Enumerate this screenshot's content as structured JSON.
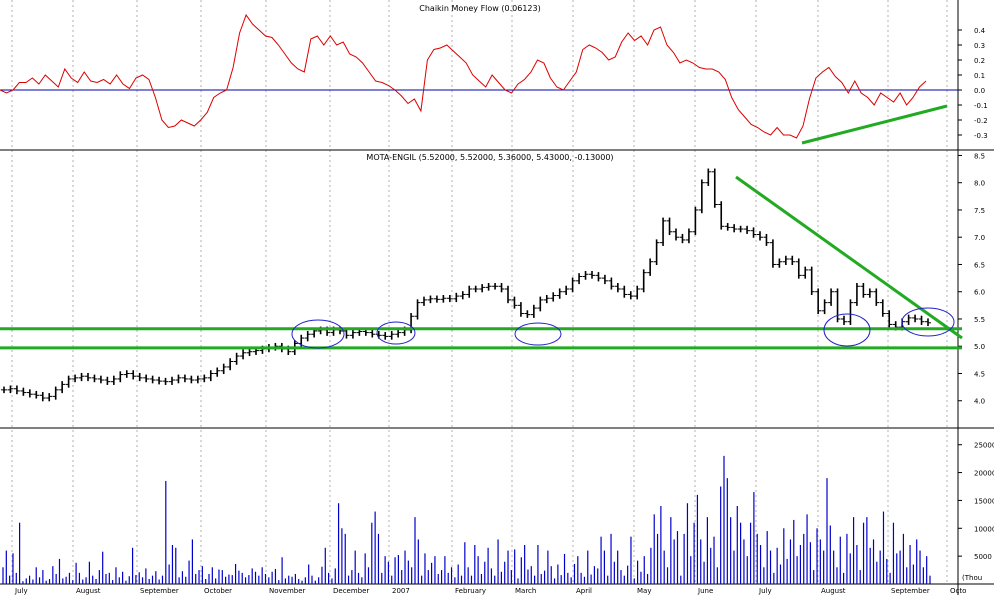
{
  "chart_data": [
    {
      "type": "line",
      "title": "Chaikin Money Flow (0.06123)",
      "ylim": [
        -0.4,
        0.6
      ],
      "y_ticks": [
        "0.4",
        "0.3",
        "0.2",
        "0.1",
        "0.0",
        "-0.1",
        "-0.2",
        "-0.3"
      ],
      "baseline": 0.0,
      "series": [
        {
          "color": "#dd0000",
          "values": [
            0.0,
            -0.02,
            0.0,
            0.05,
            0.05,
            0.08,
            0.04,
            0.1,
            0.06,
            0.02,
            0.14,
            0.08,
            0.05,
            0.12,
            0.06,
            0.05,
            0.07,
            0.04,
            0.1,
            0.04,
            0.01,
            0.08,
            0.1,
            0.07,
            -0.05,
            -0.2,
            -0.25,
            -0.24,
            -0.2,
            -0.22,
            -0.24,
            -0.2,
            -0.15,
            -0.05,
            -0.02,
            0.0,
            0.15,
            0.38,
            0.5,
            0.44,
            0.4,
            0.36,
            0.35,
            0.3,
            0.24,
            0.18,
            0.14,
            0.12,
            0.34,
            0.36,
            0.3,
            0.36,
            0.3,
            0.32,
            0.24,
            0.22,
            0.18,
            0.12,
            0.06,
            0.05,
            0.03,
            0.0,
            -0.04,
            -0.09,
            -0.06,
            -0.14,
            0.2,
            0.27,
            0.28,
            0.3,
            0.26,
            0.22,
            0.18,
            0.1,
            0.06,
            0.02,
            0.1,
            0.05,
            0.0,
            -0.02,
            0.04,
            0.07,
            0.12,
            0.2,
            0.18,
            0.08,
            0.02,
            0.0,
            0.06,
            0.12,
            0.27,
            0.3,
            0.28,
            0.25,
            0.2,
            0.22,
            0.32,
            0.38,
            0.33,
            0.36,
            0.3,
            0.4,
            0.42,
            0.3,
            0.25,
            0.18,
            0.2,
            0.18,
            0.15,
            0.14,
            0.14,
            0.12,
            0.07,
            -0.05,
            -0.13,
            -0.18,
            -0.23,
            -0.25,
            -0.28,
            -0.3,
            -0.25,
            -0.3,
            -0.3,
            -0.32,
            -0.24,
            -0.06,
            0.08,
            0.12,
            0.15,
            0.09,
            0.05,
            -0.02,
            0.06,
            -0.02,
            -0.05,
            -0.1,
            -0.02,
            -0.05,
            -0.08,
            -0.02,
            -0.1,
            -0.05,
            0.02,
            0.06
          ]
        }
      ]
    },
    {
      "type": "line",
      "title": "MOTA-ENGIL (5.52000, 5.52000, 5.36000, 5.43000, -0.13000)",
      "ylim": [
        3.5,
        8.6
      ],
      "y_ticks": [
        "8.5",
        "8.0",
        "7.5",
        "7.0",
        "6.5",
        "6.0",
        "5.5",
        "5.0",
        "4.5",
        "4.0"
      ],
      "series": [
        {
          "color": "#000000",
          "values": [
            4.2,
            4.22,
            4.18,
            4.15,
            4.12,
            4.1,
            4.05,
            4.08,
            4.2,
            4.3,
            4.4,
            4.42,
            4.45,
            4.42,
            4.4,
            4.38,
            4.35,
            4.4,
            4.48,
            4.5,
            4.45,
            4.42,
            4.4,
            4.38,
            4.36,
            4.35,
            4.38,
            4.42,
            4.4,
            4.38,
            4.4,
            4.42,
            4.5,
            4.55,
            4.62,
            4.72,
            4.82,
            4.88,
            4.9,
            4.92,
            4.95,
            4.98,
            5.0,
            4.95,
            4.9,
            5.05,
            5.15,
            5.22,
            5.28,
            5.3,
            5.25,
            5.3,
            5.28,
            5.2,
            5.25,
            5.27,
            5.25,
            5.22,
            5.2,
            5.18,
            5.22,
            5.25,
            5.3,
            5.55,
            5.8,
            5.85,
            5.87,
            5.86,
            5.88,
            5.87,
            5.92,
            5.95,
            6.05,
            6.05,
            6.08,
            6.1,
            6.1,
            6.05,
            5.85,
            5.75,
            5.6,
            5.58,
            5.7,
            5.85,
            5.88,
            5.93,
            6.0,
            6.05,
            6.2,
            6.28,
            6.32,
            6.3,
            6.25,
            6.2,
            6.1,
            6.05,
            5.95,
            5.92,
            6.05,
            6.35,
            6.55,
            6.9,
            7.3,
            7.1,
            7.0,
            6.95,
            7.1,
            7.5,
            8.0,
            8.2,
            7.6,
            7.2,
            7.18,
            7.15,
            7.15,
            7.12,
            7.05,
            7.0,
            6.9,
            6.5,
            6.55,
            6.6,
            6.55,
            6.3,
            6.4,
            6.0,
            5.65,
            5.8,
            6.0,
            5.5,
            5.45,
            5.8,
            6.1,
            5.95,
            6.0,
            5.8,
            5.6,
            5.4,
            5.35,
            5.45,
            5.52,
            5.5,
            5.45,
            5.43
          ]
        }
      ],
      "annotations": {
        "support_lines": [
          5.32,
          4.97
        ],
        "trendline_from": [
          0,
          8.3
        ],
        "trendline_to": [
          1,
          5.28
        ]
      }
    },
    {
      "type": "bar",
      "title": "",
      "ylim": [
        0,
        28000
      ],
      "y_ticks": [
        "25000",
        "20000",
        "15000",
        "10000",
        "5000"
      ],
      "unit_label": "(Thou",
      "x_labels": [
        "July",
        "August",
        "September",
        "October",
        "November",
        "December",
        "2007",
        "February",
        "March",
        "April",
        "May",
        "June",
        "July",
        "August",
        "September",
        "Octo"
      ],
      "series": [
        {
          "color": "#0000cc",
          "values": [
            3000,
            6000,
            1500,
            5500,
            2000,
            11000,
            500,
            1000,
            1500,
            800,
            3000,
            1200,
            2500,
            600,
            900,
            3200,
            1800,
            4500,
            1000,
            1300,
            2000,
            700,
            3800,
            2000,
            800,
            1200,
            4000,
            1500,
            900,
            2500,
            5800,
            1800,
            2000,
            700,
            3000,
            1200,
            2200,
            600,
            1400,
            6500,
            1600,
            2100,
            1200,
            2800,
            900,
            1500,
            2300,
            800,
            1500,
            18500,
            3500,
            7000,
            6500,
            1200,
            2300,
            1300,
            4200,
            8000,
            1800,
            2500,
            3200,
            900,
            1800,
            3000,
            1000,
            2600,
            2500,
            1300,
            1700,
            1600,
            3600,
            2400,
            2000,
            1200,
            1600,
            2800,
            2200,
            1500,
            3000,
            1800,
            1200,
            2200,
            2700,
            700,
            4800,
            1000,
            1500,
            1300,
            1800,
            900,
            600,
            1200,
            3500,
            1500,
            600,
            1200,
            3100,
            6500,
            2000,
            1000,
            2800,
            14500,
            10000,
            9000,
            1500,
            2500,
            6000,
            2000,
            1200,
            5500,
            3000,
            11000,
            13000,
            9000,
            2000,
            5000,
            4000,
            1500,
            4800,
            5200,
            2500,
            6000,
            4200,
            3000,
            12000,
            8000,
            1500,
            5500,
            2500,
            3800,
            5000,
            1800,
            2500,
            5000,
            2000,
            3000,
            1200,
            3500,
            1500,
            7500,
            3000,
            1500,
            7000,
            5000,
            1800,
            4000,
            6500,
            2800,
            1500,
            8000,
            2200,
            4000,
            6000,
            2500,
            6200,
            1000,
            4800,
            7000,
            2600,
            3200,
            1500,
            7000,
            1800,
            2400,
            6000,
            3200,
            1000,
            3500,
            1600,
            5400,
            2000,
            1200,
            3600,
            5000,
            2000,
            1300,
            6000,
            1700,
            3200,
            2800,
            8500,
            6000,
            1500,
            9000,
            4000,
            6000,
            2500,
            1500,
            3300,
            8500,
            1000,
            4200,
            2200,
            5000,
            1800,
            6500,
            12500,
            9000,
            14000,
            6000,
            3000,
            12000,
            8000,
            9500,
            1500,
            9000,
            14500,
            5000,
            11000,
            16000,
            8000,
            4000,
            12000,
            6500,
            8500,
            3000,
            17500,
            23000,
            19000,
            12000,
            6000,
            14000,
            11000,
            8000,
            5000,
            11000,
            16500,
            9000,
            7000,
            3000,
            9500,
            6000,
            2000,
            6500,
            3500,
            10000,
            4500,
            8000,
            11500,
            5000,
            7000,
            9000,
            12500,
            7500,
            2500,
            10000,
            8000,
            6000,
            19000,
            10500,
            6000,
            3000,
            8500,
            2000,
            9000,
            5500,
            12000,
            7000,
            2500,
            11000,
            12000,
            6500,
            8000,
            4000,
            6000,
            13000,
            4500,
            2000,
            11000,
            5500,
            6000,
            9000,
            3000,
            7000,
            3500,
            8000,
            6000,
            3000,
            5000,
            1500
          ]
        }
      ]
    }
  ]
}
